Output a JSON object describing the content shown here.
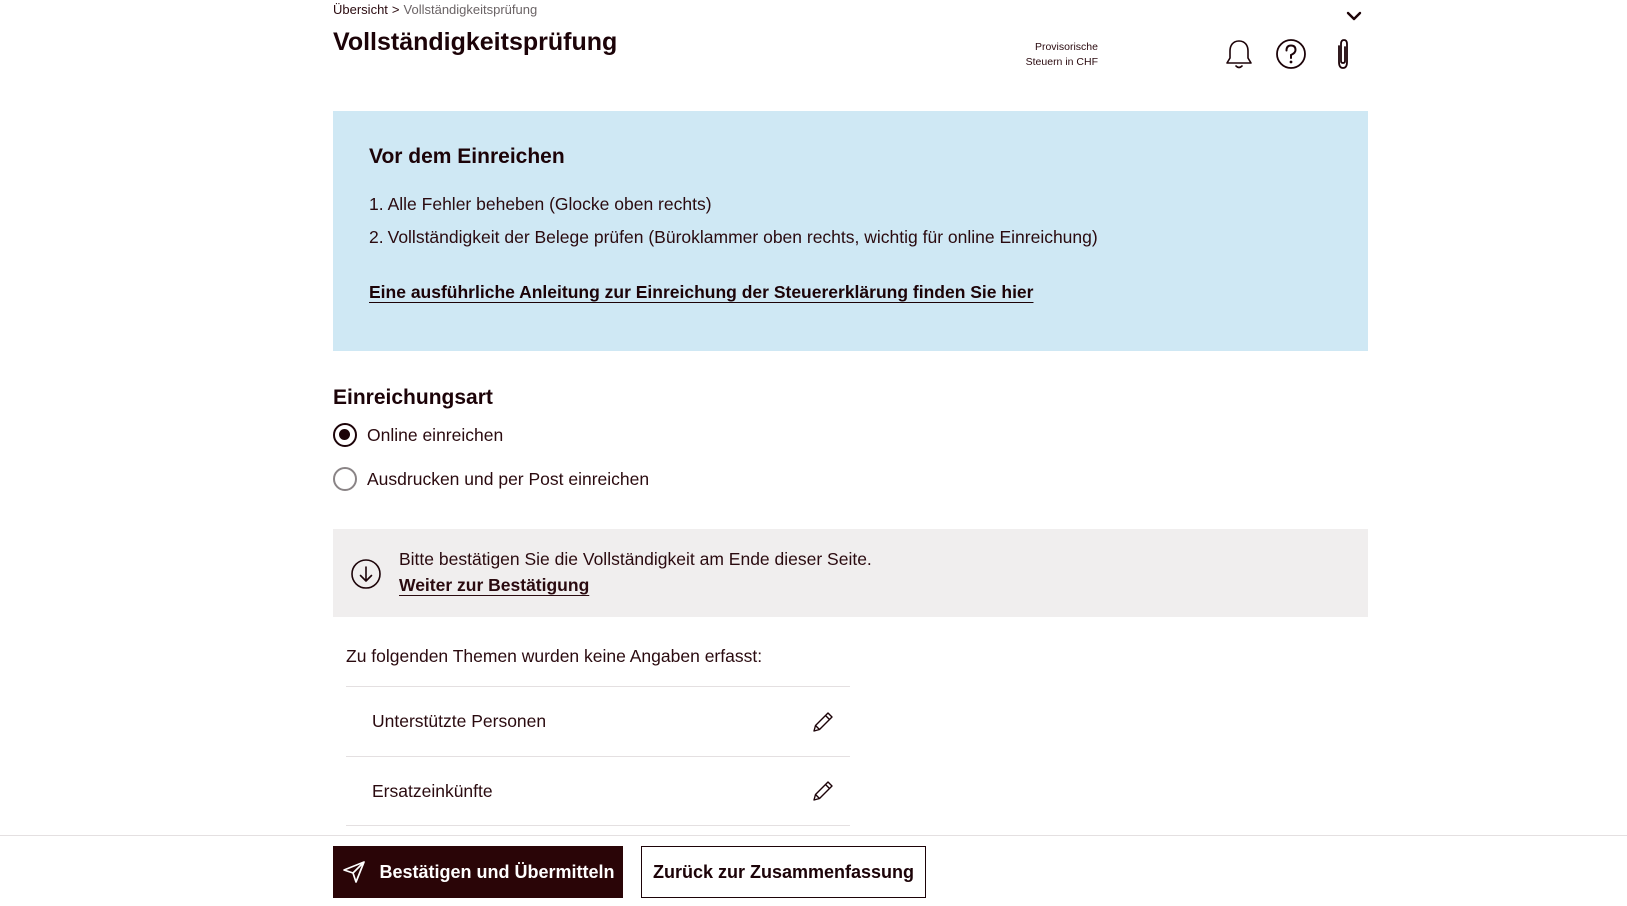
{
  "breadcrumb": {
    "root": "Übersicht",
    "separator": ">",
    "current": "Vollständigkeitsprüfung"
  },
  "header": {
    "title": "Vollständigkeitsprüfung",
    "provisional_line1": "Provisorische",
    "provisional_line2": "Steuern in CHF"
  },
  "info": {
    "title": "Vor dem Einreichen",
    "items": [
      {
        "num": "1.",
        "text": "Alle Fehler beheben (Glocke oben rechts)"
      },
      {
        "num": "2.",
        "text": "Vollständigkeit der Belege prüfen (Büroklammer oben rechts, wichtig für online Einreichung)"
      }
    ],
    "link": "Eine ausführliche Anleitung zur Einreichung der Steuererklärung finden Sie hier"
  },
  "submission": {
    "title": "Einreichungsart",
    "options": [
      {
        "label": "Online einreichen",
        "selected": true
      },
      {
        "label": "Ausdrucken und per Post einreichen",
        "selected": false
      }
    ]
  },
  "notice": {
    "text": "Bitte bestätigen Sie die Vollständigkeit am Ende dieser Seite.",
    "link": "Weiter zur Bestätigung"
  },
  "topics": {
    "intro": "Zu folgenden Themen wurden keine Angaben erfasst:",
    "items": [
      {
        "label": "Unterstützte Personen"
      },
      {
        "label": "Ersatzeinkünfte"
      }
    ]
  },
  "footer": {
    "primary_label": "Bestätigen und Übermitteln",
    "secondary_label": "Zurück zur Zusammenfassung"
  },
  "colors": {
    "primary": "#2a0507",
    "info_bg": "#cfe8f4",
    "notice_bg": "#f0eeee",
    "text": "#1c0308"
  }
}
